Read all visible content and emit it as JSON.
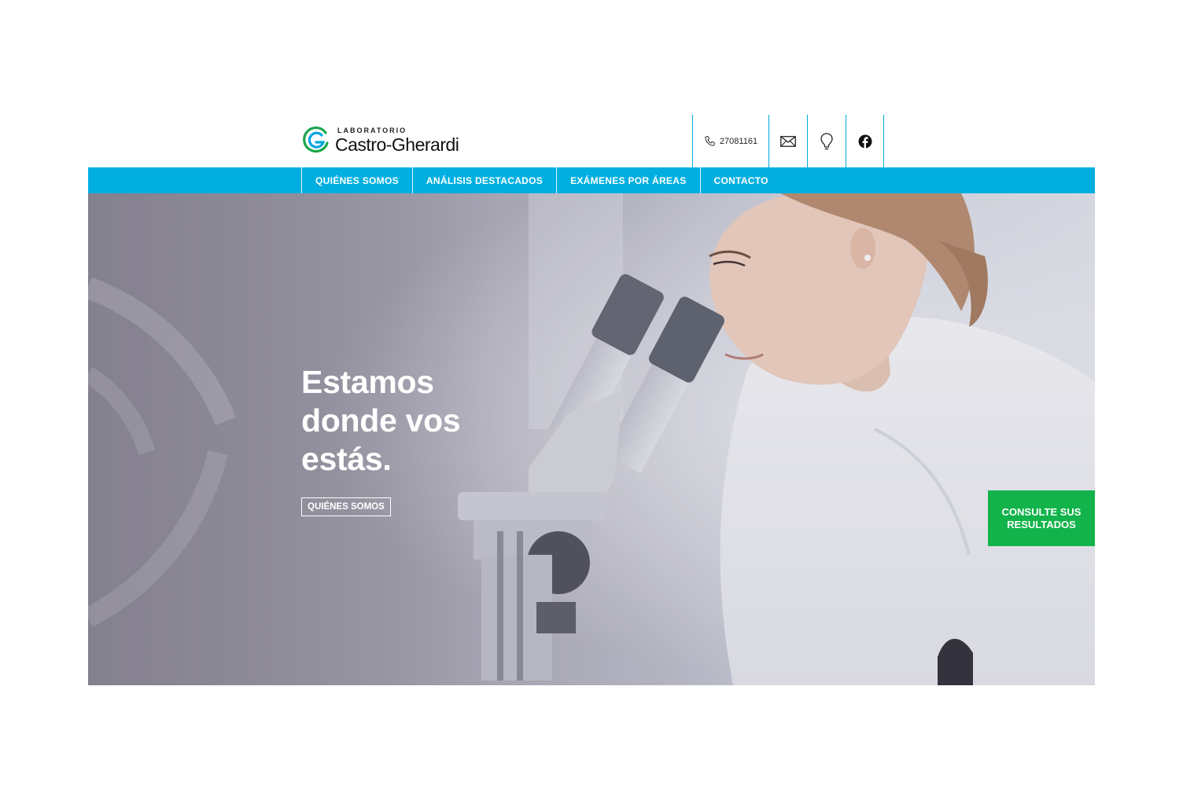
{
  "header": {
    "logo": {
      "top_text": "LABORATORIO",
      "main_text": "Castro-Gherardi"
    },
    "contact": {
      "phone": "27081161",
      "phone_icon": "phone-icon",
      "mail_icon": "mail-icon",
      "location_icon": "location-pin-icon",
      "social_icon": "facebook-icon"
    }
  },
  "nav": {
    "items": [
      {
        "label": "QUIÉNES SOMOS"
      },
      {
        "label": "ANÁLISIS DESTACADOS"
      },
      {
        "label": "EXÁMENES POR ÁREAS"
      },
      {
        "label": "CONTACTO"
      }
    ]
  },
  "hero": {
    "title_lines": [
      "Estamos",
      "donde vos",
      "estás."
    ],
    "button_label": "QUIÉNES SOMOS"
  },
  "results_button": {
    "line1": "CONSULTE SUS",
    "line2": "RESULTADOS"
  },
  "colors": {
    "nav_bg": "#00afe0",
    "results_bg": "#12b34a",
    "logo_green": "#1aa64a",
    "logo_blue": "#00a5de"
  }
}
